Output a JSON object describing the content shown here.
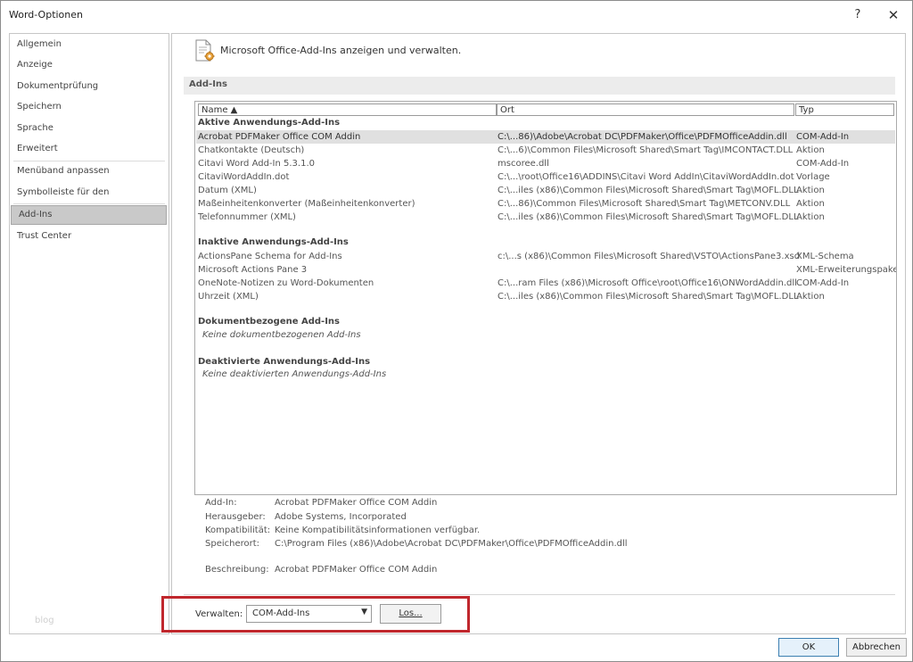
{
  "window": {
    "title": "Word-Optionen",
    "help_label": "?",
    "close_label": "✕"
  },
  "sidebar": {
    "items": [
      {
        "label": "Allgemein"
      },
      {
        "label": "Anzeige"
      },
      {
        "label": "Dokumentprüfung"
      },
      {
        "label": "Speichern"
      },
      {
        "label": "Sprache"
      },
      {
        "label": "Erweitert"
      },
      {
        "label": "Menüband anpassen"
      },
      {
        "label": "Symbolleiste für den Schnellzugriff"
      },
      {
        "label": "Add-Ins"
      },
      {
        "label": "Trust Center"
      }
    ],
    "active_index": 8,
    "footer_text": "blog"
  },
  "header": {
    "text": "Microsoft Office-Add-Ins anzeigen und verwalten.",
    "icon": "addin-gear-icon"
  },
  "section": {
    "label": "Add-Ins"
  },
  "table": {
    "columns": {
      "name": "Name ▲",
      "location": "Ort",
      "type": "Typ"
    },
    "groups": [
      {
        "title": "Aktive Anwendungs-Add-Ins",
        "rows": [
          {
            "name": "Acrobat PDFMaker Office COM Addin",
            "location": "C:\\...86)\\Adobe\\Acrobat DC\\PDFMaker\\Office\\PDFMOfficeAddin.dll",
            "type": "COM-Add-In",
            "selected": true
          },
          {
            "name": "Chatkontakte (Deutsch)",
            "location": "C:\\...6)\\Common Files\\Microsoft Shared\\Smart Tag\\IMCONTACT.DLL",
            "type": "Aktion"
          },
          {
            "name": "Citavi Word Add-In 5.3.1.0",
            "location": "mscoree.dll",
            "type": "COM-Add-In"
          },
          {
            "name": "CitaviWordAddIn.dot",
            "location": "C:\\...\\root\\Office16\\ADDINS\\Citavi Word AddIn\\CitaviWordAddIn.dot",
            "type": "Vorlage"
          },
          {
            "name": "Datum (XML)",
            "location": "C:\\...iles (x86)\\Common Files\\Microsoft Shared\\Smart Tag\\MOFL.DLL",
            "type": "Aktion"
          },
          {
            "name": "Maßeinheitenkonverter (Maßeinheitenkonverter)",
            "location": "C:\\...86)\\Common Files\\Microsoft Shared\\Smart Tag\\METCONV.DLL",
            "type": "Aktion"
          },
          {
            "name": "Telefonnummer (XML)",
            "location": "C:\\...iles (x86)\\Common Files\\Microsoft Shared\\Smart Tag\\MOFL.DLL",
            "type": "Aktion"
          }
        ]
      },
      {
        "title": "Inaktive Anwendungs-Add-Ins",
        "rows": [
          {
            "name": "ActionsPane Schema for Add-Ins",
            "location": "c:\\...s (x86)\\Common Files\\Microsoft Shared\\VSTO\\ActionsPane3.xsd",
            "type": "XML-Schema"
          },
          {
            "name": "Microsoft Actions Pane 3",
            "location": "",
            "type": "XML-Erweiterungspaket"
          },
          {
            "name": "OneNote-Notizen zu Word-Dokumenten",
            "location": "C:\\...ram Files (x86)\\Microsoft Office\\root\\Office16\\ONWordAddin.dll",
            "type": "COM-Add-In"
          },
          {
            "name": "Uhrzeit (XML)",
            "location": "C:\\...iles (x86)\\Common Files\\Microsoft Shared\\Smart Tag\\MOFL.DLL",
            "type": "Aktion"
          }
        ]
      },
      {
        "title": "Dokumentbezogene Add-Ins",
        "empty_note": "Keine dokumentbezogenen Add-Ins"
      },
      {
        "title": "Deaktivierte Anwendungs-Add-Ins",
        "empty_note": "Keine deaktivierten Anwendungs-Add-Ins"
      }
    ]
  },
  "details": {
    "addin_label": "Add-In:",
    "addin_value": "Acrobat PDFMaker Office COM Addin",
    "publisher_label": "Herausgeber:",
    "publisher_value": "Adobe Systems, Incorporated",
    "compat_label": "Kompatibilität:",
    "compat_value": "Keine Kompatibilitätsinformationen verfügbar.",
    "location_label": "Speicherort:",
    "location_value": "C:\\Program Files (x86)\\Adobe\\Acrobat DC\\PDFMaker\\Office\\PDFMOfficeAddin.dll",
    "desc_label": "Beschreibung:",
    "desc_value": "Acrobat PDFMaker Office COM Addin"
  },
  "manage": {
    "label": "Verwalten:",
    "selected": "COM-Add-Ins",
    "go_label": "Los...",
    "highlight_color": "#c0272d"
  },
  "buttons": {
    "ok": "OK",
    "cancel": "Abbrechen"
  }
}
